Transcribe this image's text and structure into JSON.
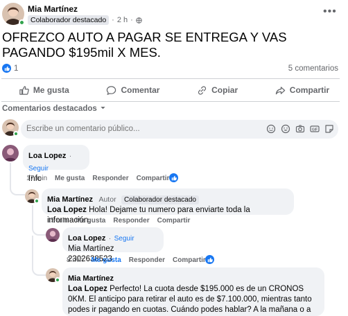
{
  "post": {
    "author": "Mia Martínez",
    "badge": "Colaborador destacado",
    "time": "2 h",
    "text": "OFREZCO AUTO A PAGAR SE ENTREGA Y VAS PAGANDO $195mil X MES.",
    "reaction_count": "1",
    "comments_count": "5 comentarios"
  },
  "actions": {
    "like": "Me gusta",
    "comment": "Comentar",
    "copy": "Copiar",
    "share": "Compartir"
  },
  "featured_label": "Comentarios destacados",
  "composer": {
    "placeholder": "Escribe un comentario público..."
  },
  "comments": [
    {
      "name": "Loa Lopez",
      "follow": "Seguir",
      "text": "Info",
      "time": "17 min",
      "like": "Me gusta",
      "reply": "Responder",
      "share": "Compartir"
    },
    {
      "name": "Mia Martínez",
      "author_tag": "Autor",
      "badge": "Colaborador destacado",
      "mention": "Loa Lopez",
      "text": " Hola! Dejame tu numero para enviarte toda la información.",
      "time": "15 min",
      "like": "Me gusta",
      "reply": "Responder",
      "share": "Compartir"
    },
    {
      "name": "Loa Lopez",
      "follow": "Seguir",
      "mention": "Mia Martínez",
      "text": " 2302638523",
      "time": "8 min",
      "like": "Me gusta",
      "reply": "Responder",
      "share": "Compartir"
    },
    {
      "name": "Mia Martínez",
      "mention": "Loa Lopez",
      "text": " Perfecto! La cuota desde $195.000 es de un CRONOS 0KM. El anticipo para retirar el auto es de $7.100.000, mientras tanto podes ir pagando en cuotas. Cuándo podes hablar? A la mañana o a la tarde?"
    }
  ],
  "colors": {
    "accent": "#1877f2",
    "secondary_text": "#65676b",
    "bubble": "#f0f2f5",
    "online": "#31a24c"
  },
  "icons": [
    "more-options-icon",
    "globe-icon",
    "like-reaction-icon",
    "thumbs-up-icon",
    "comment-icon",
    "copy-icon",
    "share-icon",
    "chevron-down-icon",
    "emoji-icon",
    "avatar-sticker-icon",
    "camera-icon",
    "gif-icon",
    "sticker-icon"
  ]
}
